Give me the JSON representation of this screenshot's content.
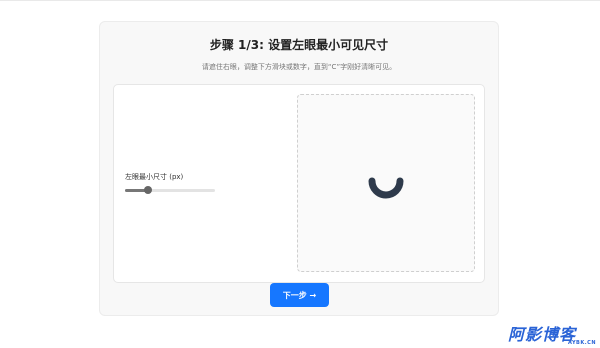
{
  "step": {
    "title": "步骤 1/3: 设置左眼最小可见尺寸",
    "instruction": "请遮住右眼，调整下方滑块或数字，直到“C”字刚好清晰可见。"
  },
  "slider": {
    "label": "左眼最小尺寸 (px)",
    "value_fraction": 0.26
  },
  "optotype": {
    "glyph": "C",
    "color": "#2e3a4b"
  },
  "actions": {
    "next_label": "下一步 →"
  },
  "watermark": {
    "brand": "阿影博客",
    "url": "AYBK.CN"
  },
  "colors": {
    "accent": "#1677ff",
    "brand": "#2a63d6"
  }
}
